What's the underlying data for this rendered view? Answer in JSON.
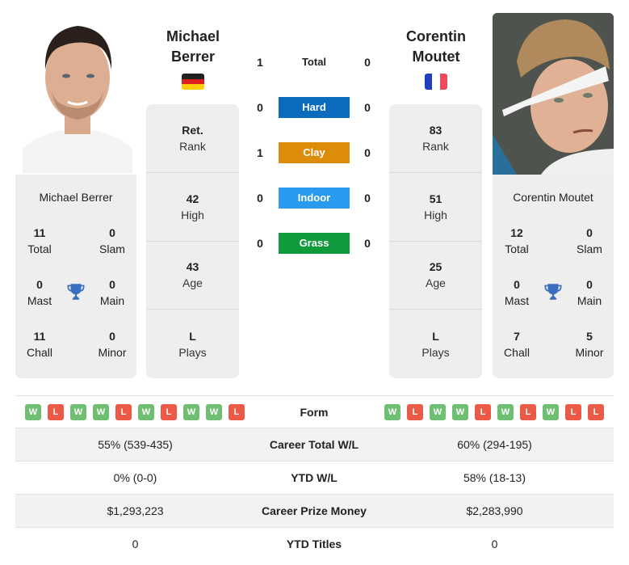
{
  "player_left": {
    "name_line1": "Michael",
    "name_line2": "Berrer",
    "full_name": "Michael Berrer",
    "country_flag": "germany-flag",
    "flag_colors": [
      "#222222",
      "#dd1f1f",
      "#ffce00"
    ],
    "info": [
      {
        "value": "Ret.",
        "label": "Rank"
      },
      {
        "value": "42",
        "label": "High"
      },
      {
        "value": "43",
        "label": "Age"
      },
      {
        "value": "L",
        "label": "Plays"
      }
    ],
    "titles": {
      "total": {
        "value": "11",
        "label": "Total"
      },
      "slam": {
        "value": "0",
        "label": "Slam"
      },
      "mast": {
        "value": "0",
        "label": "Mast"
      },
      "main": {
        "value": "0",
        "label": "Main"
      },
      "chall": {
        "value": "11",
        "label": "Chall"
      },
      "minor": {
        "value": "0",
        "label": "Minor"
      }
    },
    "form": [
      "W",
      "L",
      "W",
      "W",
      "L",
      "W",
      "L",
      "W",
      "W",
      "L"
    ]
  },
  "player_right": {
    "name_line1": "Corentin",
    "name_line2": "Moutet",
    "full_name": "Corentin Moutet",
    "country_flag": "france-flag",
    "flag_colors": [
      "#1f3fbf",
      "#ffffff",
      "#ef4b5a"
    ],
    "info": [
      {
        "value": "83",
        "label": "Rank"
      },
      {
        "value": "51",
        "label": "High"
      },
      {
        "value": "25",
        "label": "Age"
      },
      {
        "value": "L",
        "label": "Plays"
      }
    ],
    "titles": {
      "total": {
        "value": "12",
        "label": "Total"
      },
      "slam": {
        "value": "0",
        "label": "Slam"
      },
      "mast": {
        "value": "0",
        "label": "Mast"
      },
      "main": {
        "value": "0",
        "label": "Main"
      },
      "chall": {
        "value": "7",
        "label": "Chall"
      },
      "minor": {
        "value": "5",
        "label": "Minor"
      }
    },
    "form": [
      "W",
      "L",
      "W",
      "W",
      "L",
      "W",
      "L",
      "W",
      "L",
      "L"
    ]
  },
  "h2h": [
    {
      "label": "Total",
      "left": "1",
      "right": "0",
      "color": null
    },
    {
      "label": "Hard",
      "left": "0",
      "right": "0",
      "color": "#0a6bbf"
    },
    {
      "label": "Clay",
      "left": "1",
      "right": "0",
      "color": "#dd8c0a"
    },
    {
      "label": "Indoor",
      "left": "0",
      "right": "0",
      "color": "#2a9af0"
    },
    {
      "label": "Grass",
      "left": "0",
      "right": "0",
      "color": "#0f9a3c"
    }
  ],
  "form_label": "Form",
  "stats": [
    {
      "label": "Career Total W/L",
      "left": "55% (539-435)",
      "right": "60% (294-195)"
    },
    {
      "label": "YTD W/L",
      "left": "0% (0-0)",
      "right": "58% (18-13)"
    },
    {
      "label": "Career Prize Money",
      "left": "$1,293,223",
      "right": "$2,283,990"
    },
    {
      "label": "YTD Titles",
      "left": "0",
      "right": "0"
    }
  ]
}
